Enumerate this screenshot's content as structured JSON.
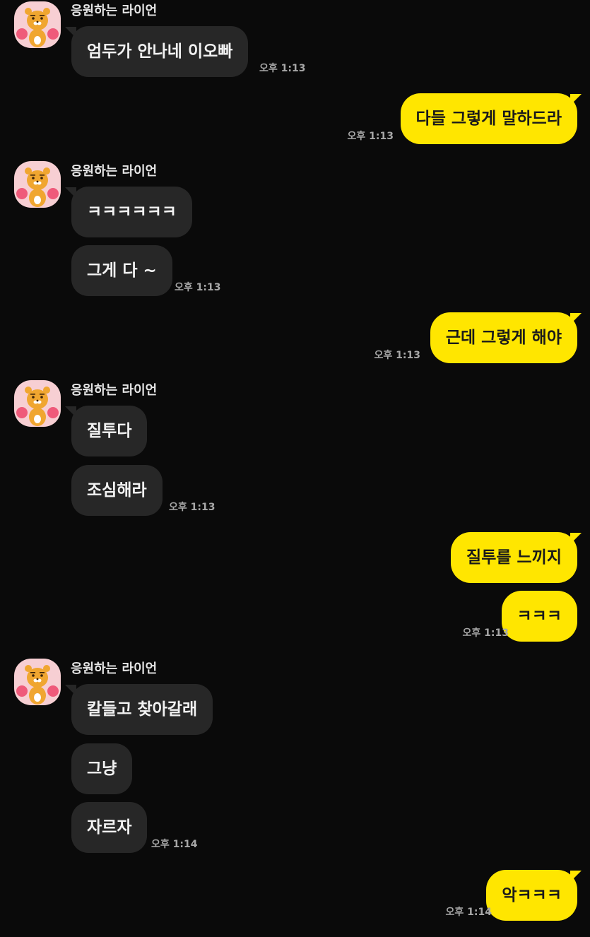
{
  "chat": {
    "sender_name": "응원하는 라이언",
    "avatar_icon": "ryan-cheering-icon",
    "incoming_bubble_color": "#272727",
    "outgoing_bubble_color": "#ffe600",
    "groups": [
      {
        "direction": "incoming",
        "sender": "응원하는 라이언",
        "messages": [
          "엄두가 안나네 이오빠"
        ],
        "time": "오후 1:13"
      },
      {
        "direction": "outgoing",
        "messages": [
          "다들 그렇게 말하드라"
        ],
        "time": "오후 1:13"
      },
      {
        "direction": "incoming",
        "sender": "응원하는 라이언",
        "messages": [
          "ㅋㅋㅋㅋㅋㅋ",
          "그게 다 ~"
        ],
        "time": "오후 1:13"
      },
      {
        "direction": "outgoing",
        "messages": [
          "근데 그렇게 해야"
        ],
        "time": "오후 1:13"
      },
      {
        "direction": "incoming",
        "sender": "응원하는 라이언",
        "messages": [
          "질투다",
          "조심해라"
        ],
        "time": "오후 1:13"
      },
      {
        "direction": "outgoing",
        "messages": [
          "질투를 느끼지",
          "ㅋㅋㅋ"
        ],
        "time": "오후 1:13"
      },
      {
        "direction": "incoming",
        "sender": "응원하는 라이언",
        "messages": [
          "칼들고 찾아갈래",
          "그냥",
          "자르자"
        ],
        "time": "오후 1:14"
      },
      {
        "direction": "outgoing",
        "messages": [
          "악ㅋㅋㅋ"
        ],
        "time": "오후 1:14"
      }
    ]
  }
}
